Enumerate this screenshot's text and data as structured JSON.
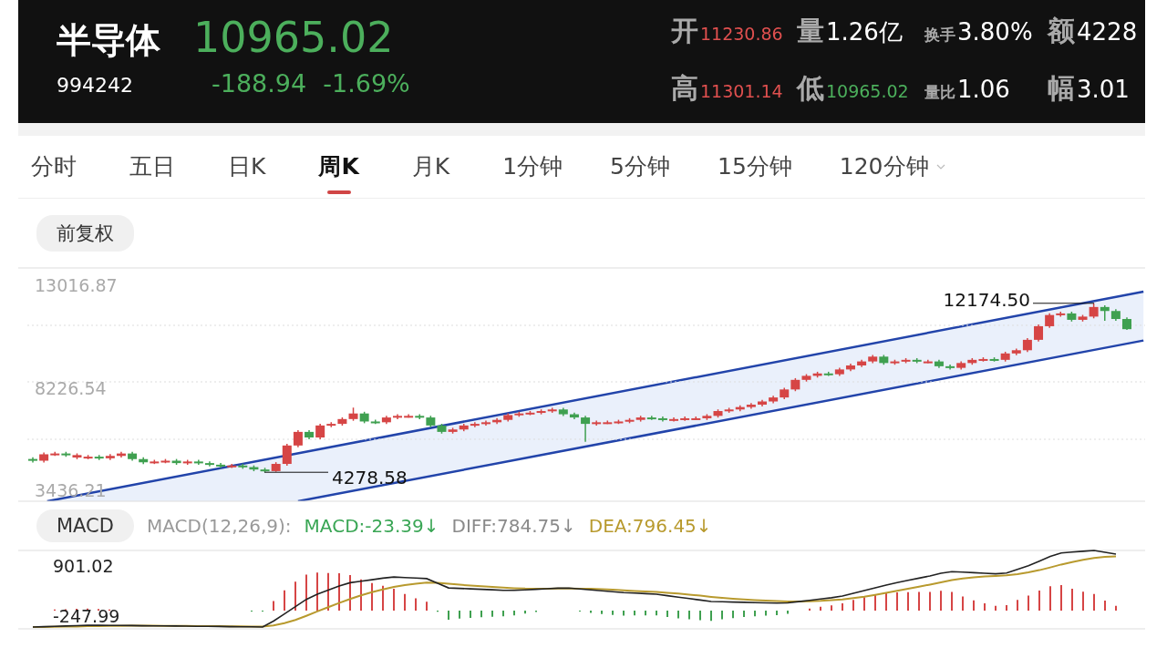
{
  "quote": {
    "name": "半导体",
    "code": "994242",
    "price": "10965.02",
    "change": "-188.94",
    "change_pct": "-1.69%",
    "color": "#4caf5c"
  },
  "stats": [
    [
      {
        "label": "开",
        "value": "11230.86",
        "color": "#e0504f"
      },
      {
        "label": "量",
        "value": "1.26亿",
        "color": "#ffffff"
      },
      {
        "label": "换手",
        "value": "3.80%",
        "color": "#ffffff"
      },
      {
        "label": "额",
        "value": "4228",
        "color": "#ffffff"
      }
    ],
    [
      {
        "label": "高",
        "value": "11301.14",
        "color": "#e0504f"
      },
      {
        "label": "低",
        "value": "10965.02",
        "color": "#4caf5c"
      },
      {
        "label": "量比",
        "value": "1.06",
        "color": "#ffffff"
      },
      {
        "label": "幅",
        "value": "3.01",
        "color": "#ffffff"
      }
    ]
  ],
  "tabs": [
    {
      "label": "分时",
      "selected": false
    },
    {
      "label": "五日",
      "selected": false
    },
    {
      "label": "日K",
      "selected": false
    },
    {
      "label": "周K",
      "selected": true
    },
    {
      "label": "月K",
      "selected": false
    },
    {
      "label": "1分钟",
      "selected": false
    },
    {
      "label": "5分钟",
      "selected": false
    },
    {
      "label": "15分钟",
      "selected": false
    },
    {
      "label": "120分钟",
      "selected": false,
      "dropdown": true
    }
  ],
  "adjust_button": "前复权",
  "price_chart": {
    "high_label": "12174.50",
    "low_label": "4278.58",
    "chart_data": {
      "type": "candlestick",
      "ylim": [
        3436.21,
        13016.87
      ],
      "yticks": [
        13016.87,
        8226.54,
        3436.21
      ],
      "ohlc": [
        [
          4900,
          4980,
          4740,
          4820
        ],
        [
          4820,
          5199,
          4740,
          5119
        ],
        [
          5119,
          5236,
          5039,
          5156
        ],
        [
          5156,
          5236,
          5002,
          5082
        ],
        [
          4969,
          5162,
          4889,
          5082
        ],
        [
          4969,
          5087,
          4889,
          5007
        ],
        [
          5007,
          5087,
          4852,
          4932
        ],
        [
          4932,
          5124,
          4852,
          5044
        ],
        [
          5044,
          5236,
          4964,
          5156
        ],
        [
          5156,
          5236,
          4815,
          4895
        ],
        [
          4895,
          4975,
          4665,
          4745
        ],
        [
          4745,
          4862,
          4665,
          4782
        ],
        [
          4782,
          4900,
          4702,
          4820
        ],
        [
          4820,
          4900,
          4628,
          4708
        ],
        [
          4708,
          4862,
          4628,
          4782
        ],
        [
          4782,
          4862,
          4628,
          4708
        ],
        [
          4708,
          4788,
          4553,
          4633
        ],
        [
          4633,
          4713,
          4478,
          4558
        ],
        [
          4558,
          4675,
          4478,
          4595
        ],
        [
          4595,
          4675,
          4441,
          4521
        ],
        [
          4521,
          4601,
          4328,
          4408
        ],
        [
          4408,
          4488,
          4278.58,
          4334
        ],
        [
          4334,
          4750,
          4300,
          4670
        ],
        [
          4670,
          5610,
          4590,
          5530
        ],
        [
          5530,
          6246,
          5450,
          6166
        ],
        [
          6166,
          6246,
          5824,
          5904
        ],
        [
          5904,
          6545,
          5824,
          6465
        ],
        [
          6465,
          6620,
          6385,
          6540
        ],
        [
          6540,
          6845,
          6460,
          6765
        ],
        [
          6765,
          7300,
          6685,
          7026
        ],
        [
          7026,
          7106,
          6572,
          6652
        ],
        [
          6652,
          6732,
          6535,
          6615
        ],
        [
          6615,
          6919,
          6535,
          6839
        ],
        [
          6839,
          6994,
          6759,
          6914
        ],
        [
          6914,
          6994,
          6834,
          6914
        ],
        [
          6914,
          6994,
          6759,
          6839
        ],
        [
          6839,
          6919,
          6385,
          6465
        ],
        [
          6465,
          6545,
          6086,
          6166
        ],
        [
          6166,
          6358,
          6086,
          6278
        ],
        [
          6278,
          6545,
          6198,
          6465
        ],
        [
          6465,
          6620,
          6385,
          6540
        ],
        [
          6540,
          6695,
          6460,
          6615
        ],
        [
          6615,
          6807,
          6535,
          6727
        ],
        [
          6727,
          7032,
          6647,
          6952
        ],
        [
          6952,
          7106,
          6872,
          7026
        ],
        [
          7026,
          7144,
          6946,
          7064
        ],
        [
          7064,
          7219,
          6984,
          7139
        ],
        [
          7139,
          7293,
          7059,
          7213
        ],
        [
          7213,
          7293,
          6909,
          6989
        ],
        [
          6989,
          7069,
          6759,
          6839
        ],
        [
          6839,
          6919,
          5700,
          6540
        ],
        [
          6540,
          6695,
          6460,
          6615
        ],
        [
          6615,
          6695,
          6535,
          6615
        ],
        [
          6615,
          6732,
          6535,
          6652
        ],
        [
          6652,
          6807,
          6572,
          6727
        ],
        [
          6727,
          6919,
          6647,
          6839
        ],
        [
          6839,
          6919,
          6722,
          6802
        ],
        [
          6802,
          6882,
          6647,
          6727
        ],
        [
          6727,
          6845,
          6647,
          6765
        ],
        [
          6765,
          6882,
          6685,
          6802
        ],
        [
          6802,
          6882,
          6722,
          6802
        ],
        [
          6802,
          6994,
          6722,
          6914
        ],
        [
          6914,
          7219,
          6834,
          7139
        ],
        [
          7139,
          7293,
          7059,
          7213
        ],
        [
          7213,
          7406,
          7133,
          7326
        ],
        [
          7326,
          7518,
          7246,
          7438
        ],
        [
          7438,
          7667,
          7358,
          7587
        ],
        [
          7587,
          7854,
          7507,
          7774
        ],
        [
          7774,
          8228,
          7694,
          8148
        ],
        [
          8148,
          8677,
          8068,
          8597
        ],
        [
          8597,
          8864,
          8517,
          8784
        ],
        [
          8784,
          8976,
          8704,
          8896
        ],
        [
          8896,
          8976,
          8779,
          8859
        ],
        [
          8859,
          9163,
          8779,
          9083
        ],
        [
          9083,
          9350,
          9003,
          9270
        ],
        [
          9270,
          9537,
          9190,
          9457
        ],
        [
          9457,
          9762,
          9377,
          9682
        ],
        [
          9682,
          9762,
          9303,
          9383
        ],
        [
          9383,
          9537,
          9303,
          9457
        ],
        [
          9457,
          9612,
          9377,
          9532
        ],
        [
          9532,
          9612,
          9377,
          9457
        ],
        [
          9457,
          9537,
          9377,
          9457
        ],
        [
          9457,
          9537,
          9153,
          9233
        ],
        [
          9233,
          9313,
          9078,
          9158
        ],
        [
          9158,
          9463,
          9078,
          9383
        ],
        [
          9383,
          9612,
          9303,
          9532
        ],
        [
          9532,
          9650,
          9452,
          9570
        ],
        [
          9570,
          9650,
          9452,
          9532
        ],
        [
          9532,
          9911,
          9452,
          9831
        ],
        [
          9831,
          10061,
          9751,
          9981
        ],
        [
          9981,
          10547,
          9901,
          10467
        ],
        [
          10467,
          11183,
          10387,
          11103
        ],
        [
          11103,
          11707,
          11023,
          11627
        ],
        [
          11627,
          11781,
          11547,
          11701
        ],
        [
          11701,
          11781,
          11322,
          11402
        ],
        [
          11402,
          11632,
          11322,
          11552
        ],
        [
          11552,
          12174.5,
          11472,
          12001
        ],
        [
          12001,
          12081,
          11360,
          11814
        ],
        [
          11814,
          11894,
          11360,
          11440
        ],
        [
          11440,
          11520,
          10930,
          10965.02
        ]
      ]
    }
  },
  "macd": {
    "button": "MACD",
    "params": "MACD(12,26,9):",
    "readings": [
      {
        "text": "MACD:-23.39↓",
        "kind": "macd"
      },
      {
        "text": "DIFF:784.75↓",
        "kind": "diff"
      },
      {
        "text": "DEA:796.45↓",
        "kind": "dea"
      }
    ],
    "top_label": "901.02",
    "bottom_label": "-247.99"
  }
}
